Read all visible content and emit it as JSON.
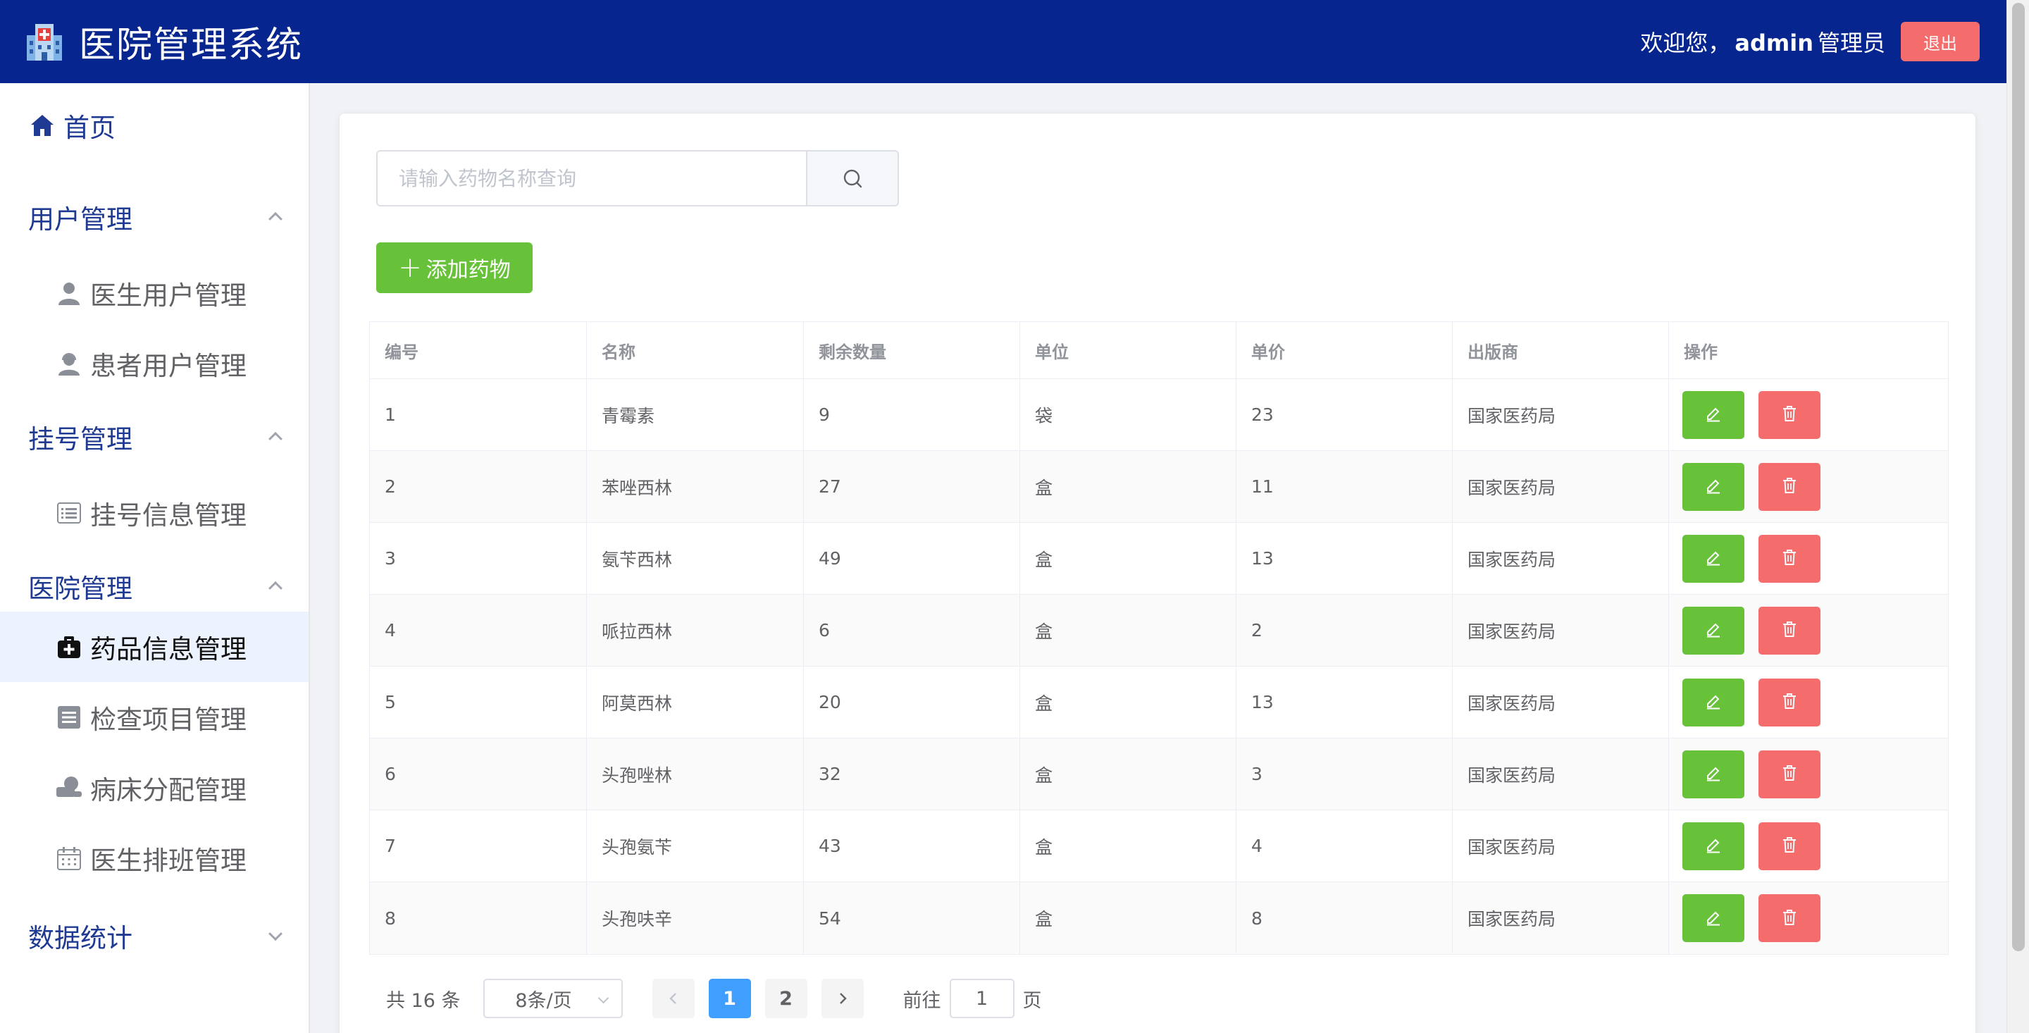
{
  "header": {
    "title": "医院管理系统",
    "welcome_prefix": "欢迎您，",
    "username": "admin",
    "role": "管理员",
    "logout_label": "退出"
  },
  "sidebar": {
    "home": "首页",
    "groups": [
      {
        "label": "用户管理",
        "expanded": true,
        "items": [
          {
            "label": "医生用户管理",
            "icon": "user-icon"
          },
          {
            "label": "患者用户管理",
            "icon": "user-headset-icon"
          }
        ]
      },
      {
        "label": "挂号管理",
        "expanded": true,
        "items": [
          {
            "label": "挂号信息管理",
            "icon": "list-icon"
          }
        ]
      },
      {
        "label": "医院管理",
        "expanded": true,
        "items": [
          {
            "label": "药品信息管理",
            "icon": "first-aid-kit-icon",
            "active": true
          },
          {
            "label": "检查项目管理",
            "icon": "document-icon"
          },
          {
            "label": "病床分配管理",
            "icon": "bed-icon"
          },
          {
            "label": "医生排班管理",
            "icon": "calendar-icon"
          }
        ]
      },
      {
        "label": "数据统计",
        "expanded": false,
        "items": []
      }
    ]
  },
  "search": {
    "placeholder": "请输入药物名称查询",
    "value": ""
  },
  "add_button_label": "添加药物",
  "table": {
    "headers": [
      "编号",
      "名称",
      "剩余数量",
      "单位",
      "单价",
      "出版商",
      "操作"
    ],
    "rows": [
      [
        "1",
        "青霉素",
        "9",
        "袋",
        "23",
        "国家医药局"
      ],
      [
        "2",
        "苯唑西林",
        "27",
        "盒",
        "11",
        "国家医药局"
      ],
      [
        "3",
        "氨苄西林",
        "49",
        "盒",
        "13",
        "国家医药局"
      ],
      [
        "4",
        "哌拉西林",
        "6",
        "盒",
        "2",
        "国家医药局"
      ],
      [
        "5",
        "阿莫西林",
        "20",
        "盒",
        "13",
        "国家医药局"
      ],
      [
        "6",
        "头孢唑林",
        "32",
        "盒",
        "3",
        "国家医药局"
      ],
      [
        "7",
        "头孢氨苄",
        "43",
        "盒",
        "4",
        "国家医药局"
      ],
      [
        "8",
        "头孢呋辛",
        "54",
        "盒",
        "8",
        "国家医药局"
      ]
    ]
  },
  "pagination": {
    "total_text": "共 16 条",
    "page_size": "8条/页",
    "pages": [
      "1",
      "2"
    ],
    "current_page": "1",
    "goto_prefix": "前往",
    "goto_value": "1",
    "goto_suffix": "页"
  },
  "colors": {
    "header": "#06258f",
    "success": "#67c23a",
    "danger": "#f56c6c",
    "primary": "#409eff"
  }
}
